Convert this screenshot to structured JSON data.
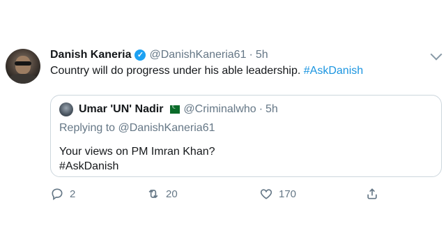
{
  "tweet": {
    "author_name": "Danish Kaneria",
    "verified": true,
    "handle": "@DanishKaneria61",
    "separator": "·",
    "time": "5h",
    "text_main": "Country will do progress under his able leadership.",
    "hashtag": "#AskDanish"
  },
  "quoted": {
    "author_name": "Umar 'UN' Nadir",
    "flag": "pakistan-flag",
    "handle": "@Criminalwho",
    "separator": "·",
    "time": "5h",
    "replying_to": "Replying to @DanishKaneria61",
    "line1": "Your views on PM Imran Khan?",
    "line2": "#AskDanish"
  },
  "actions": {
    "reply_count": "2",
    "retweet_count": "20",
    "like_count": "170"
  },
  "colors": {
    "link": "#1b95e0",
    "verified": "#1da1f2",
    "muted": "#657786",
    "border": "#ccd6dd"
  }
}
